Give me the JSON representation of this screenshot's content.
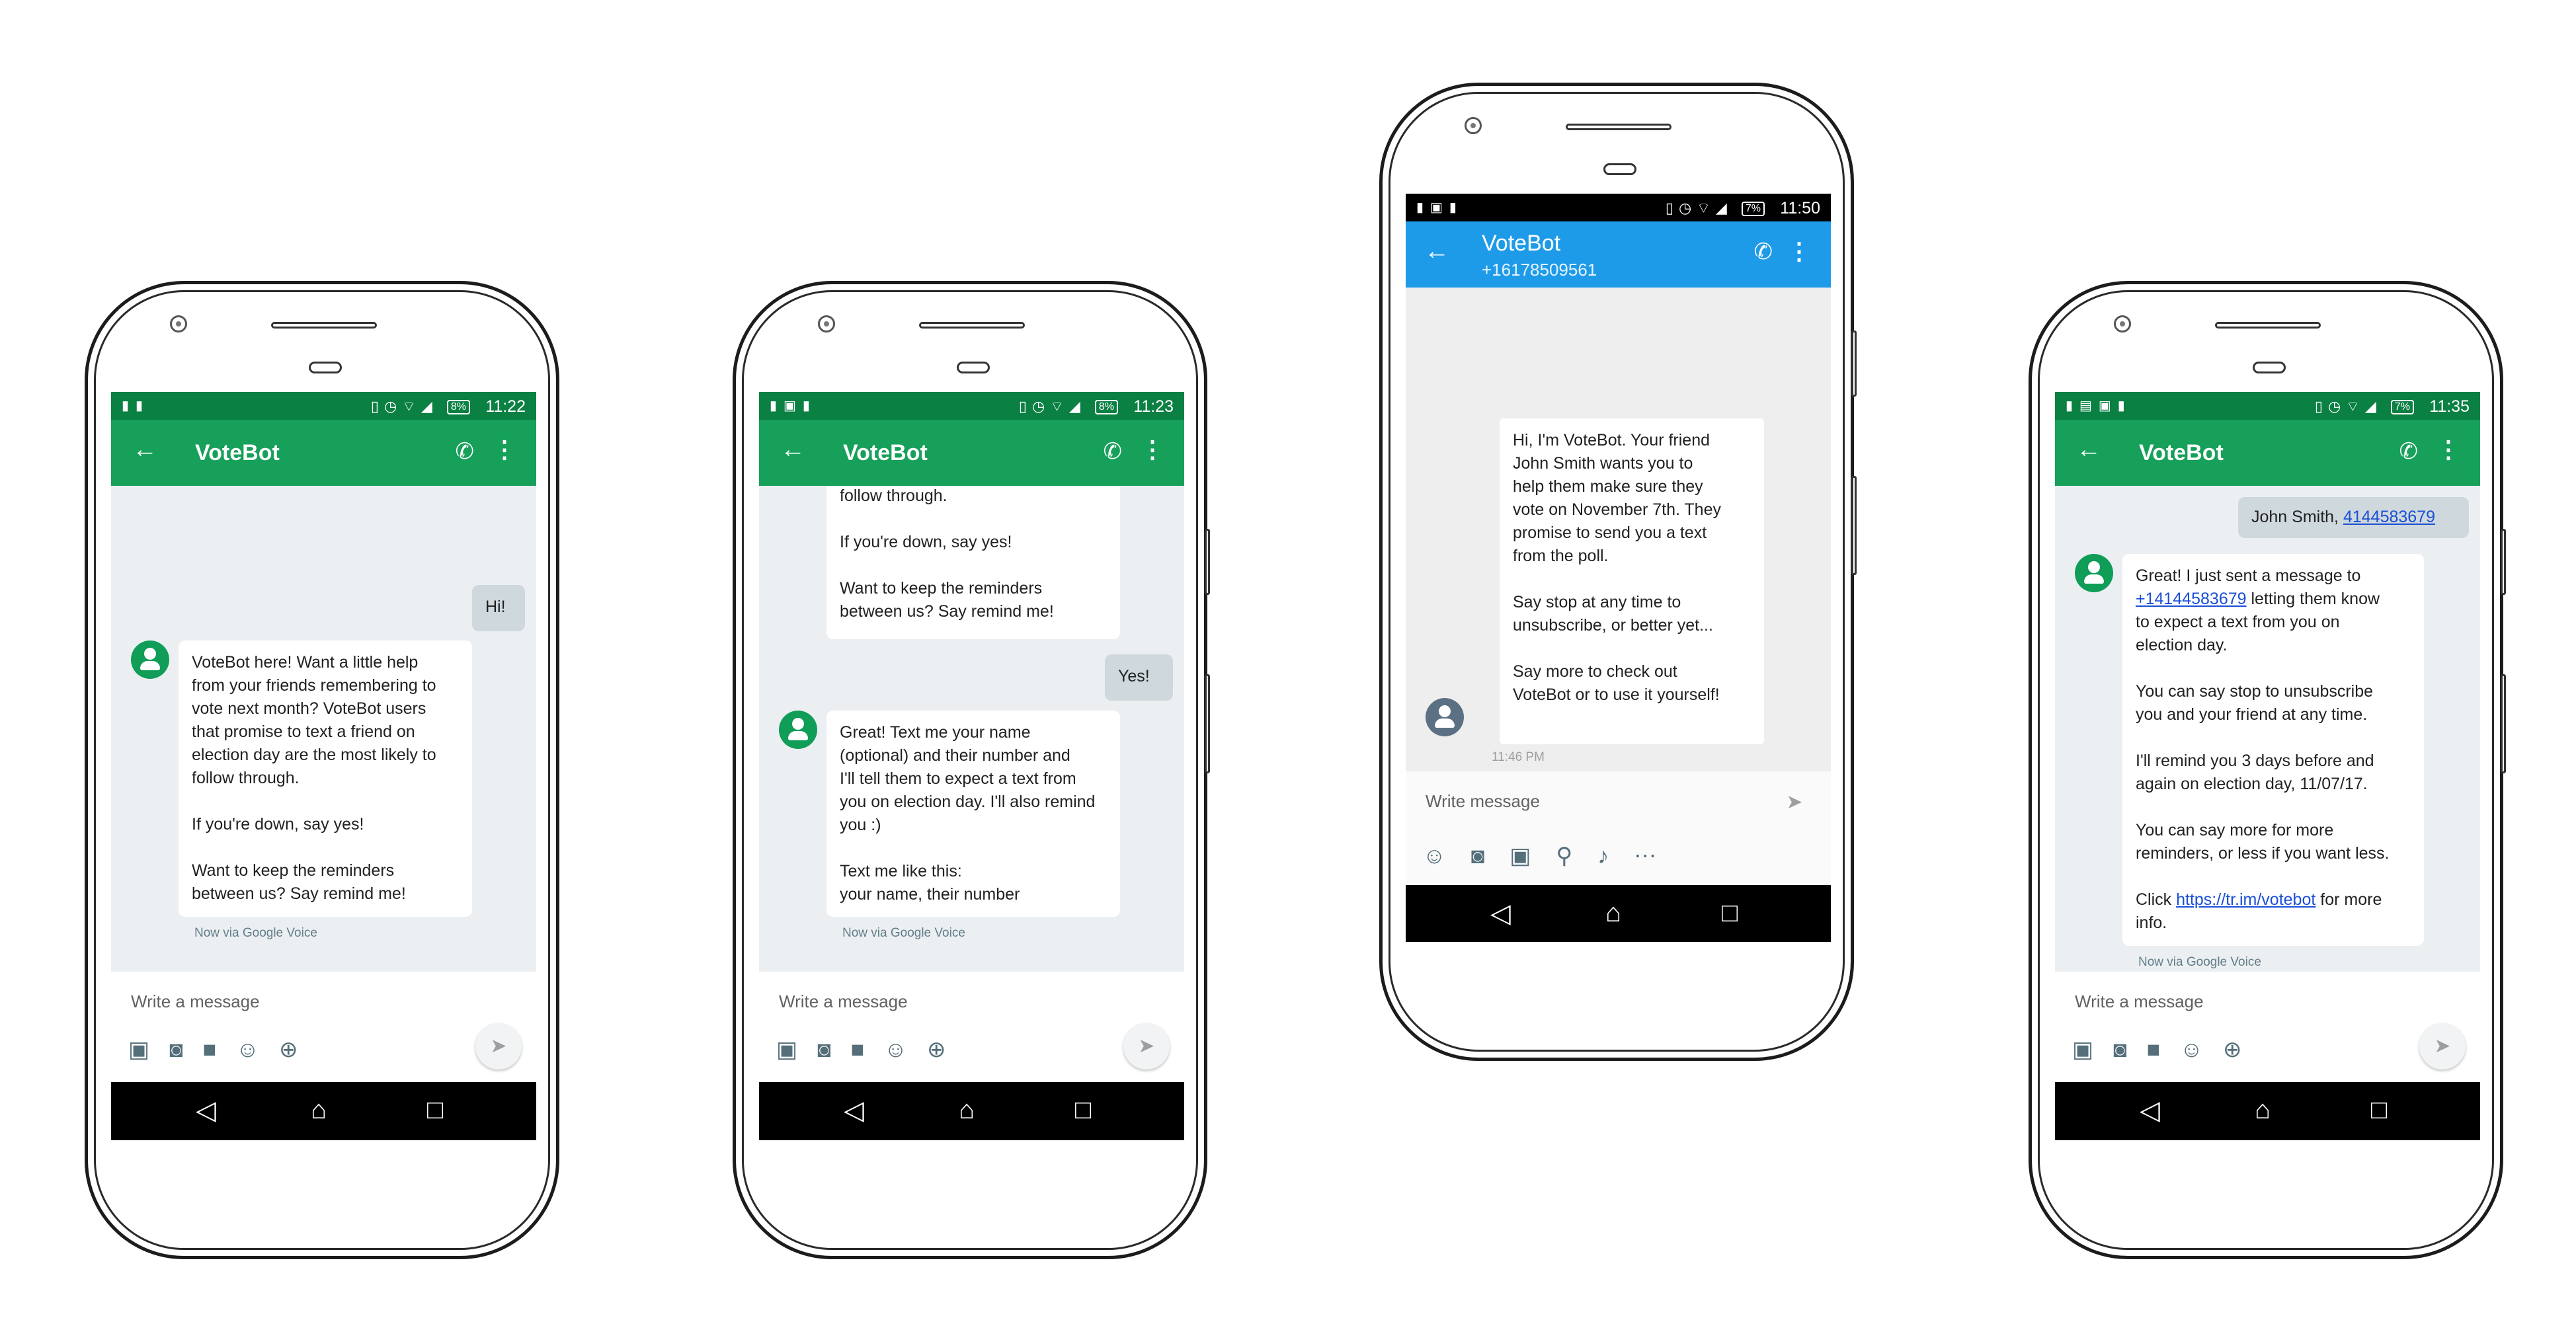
{
  "phones": [
    {
      "status": {
        "time": "11:22",
        "battery": "8%"
      },
      "contact_name": "VoteBot",
      "compose_placeholder": "Write a message",
      "outgoing_1": "Hi!",
      "incoming_1": "VoteBot here! Want a little help\nfrom your friends remembering to\nvote next month? VoteBot users\nthat promise to text a friend on\nelection day are the most likely to\nfollow through.\n\nIf you're down, say yes!\n\nWant to keep the reminders\nbetween us? Say remind me!",
      "meta": "Now via Google Voice"
    },
    {
      "status": {
        "time": "11:23",
        "battery": "8%"
      },
      "contact_name": "VoteBot",
      "compose_placeholder": "Write a message",
      "incoming_top": "follow through.\n\nIf you're down, say yes!\n\nWant to keep the reminders\nbetween us? Say remind me!",
      "outgoing_1": "Yes!",
      "incoming_1": "Great! Text me your name\n(optional) and their number and\nI'll tell them to expect a text from\nyou on election day. I'll also remind\nyou :)\n\nText me like this:\nyour name, their number",
      "meta": "Now via Google Voice"
    },
    {
      "status": {
        "time": "11:50",
        "battery": "7%"
      },
      "contact_name": "VoteBot",
      "contact_number": "+16178509561",
      "compose_placeholder": "Write message",
      "incoming_1": "Hi, I'm VoteBot. Your friend\nJohn Smith wants you to\nhelp them make sure they\nvote on November 7th. They\npromise to send you a text\nfrom the poll.\n\nSay stop at any time to\nunsubscribe, or better yet...\n\nSay more to check out\nVoteBot or to use it yourself!",
      "meta": "11:46 PM"
    },
    {
      "status": {
        "time": "11:35",
        "battery": "7%"
      },
      "contact_name": "VoteBot",
      "compose_placeholder": "Write a message",
      "outgoing_prefix": "John Smith, ",
      "outgoing_link": "4144583679",
      "incoming_p1a": "Great! I just sent a message to",
      "incoming_link1": "+14144583679",
      "incoming_p1b": " letting them know\nto expect a text from you on\nelection day.\n\nYou can say stop to unsubscribe\nyou and your friend at any time.\n\nI'll remind you 3 days before and\nagain on election day, 11/07/17.\n\nYou can say more for more\nreminders, or less if you want less.\n\nClick ",
      "incoming_link2": "https://tr.im/votebot",
      "incoming_p1c": " for more\ninfo.",
      "meta": "Now via Google Voice"
    }
  ],
  "colors": {
    "green_bar": "#16a05a",
    "green_status": "#0b8043",
    "blue_bar": "#1e9be8",
    "chat_bg": "#eceff1"
  },
  "icons": [
    "back-arrow-icon",
    "phone-icon",
    "more-vert-icon",
    "send-icon",
    "image-icon",
    "camera-icon",
    "video-icon",
    "sticker-icon",
    "location-icon",
    "mic-icon",
    "nav-back-icon",
    "nav-home-icon",
    "nav-recents-icon"
  ]
}
